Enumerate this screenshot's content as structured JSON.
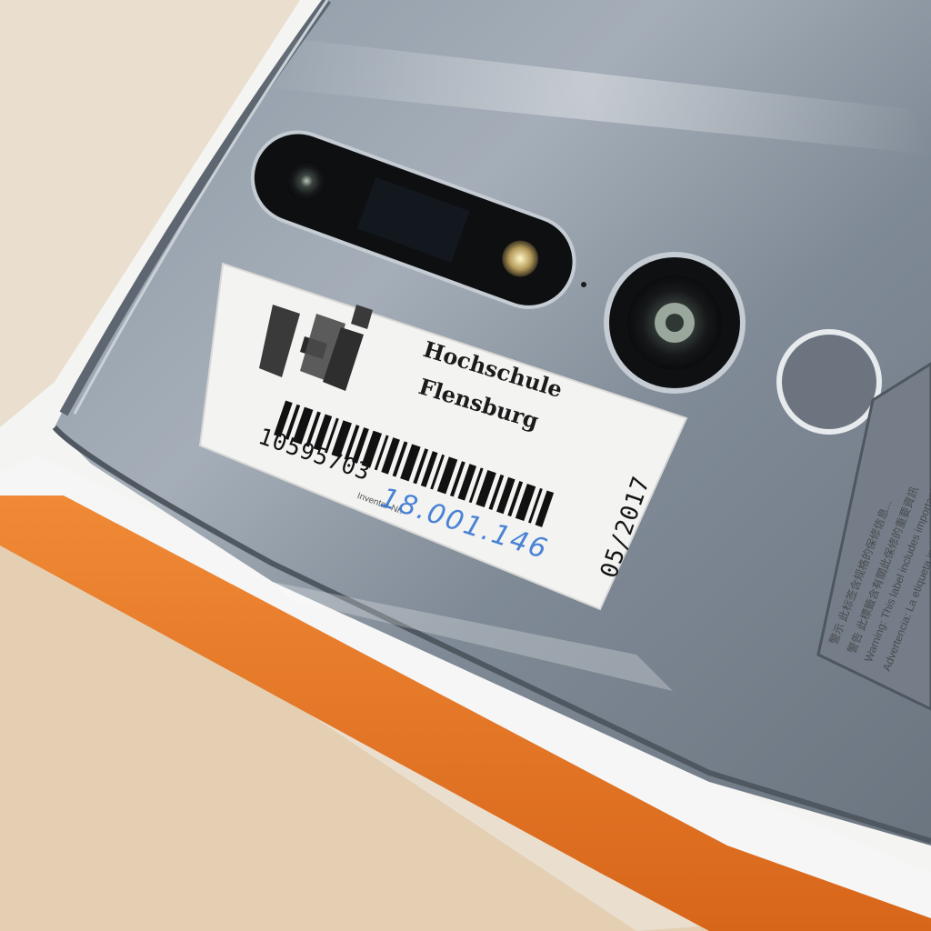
{
  "label": {
    "logo_mark": "hf",
    "org_line1": "Hochschule",
    "org_line2": "Flensburg",
    "inventory_number": "10595703",
    "inventory_caption": "Inventar-Nr.",
    "handwritten_note": "18.001.146",
    "date": "05/2017"
  },
  "back_cover": {
    "warning_lines": [
      "警示 此标签含规格的保修信息...",
      "警告 此標籤含有關此保修的重要資訊",
      "Warning: This label includes important...",
      "Advertencia: La etiqueta incluye..."
    ]
  },
  "colors": {
    "phone_body": "#7f8b97",
    "label": "#f3f3f1",
    "box_orange": "#e57423",
    "box_white": "#f4f4f4",
    "pen_blue": "#2d6fd1"
  }
}
